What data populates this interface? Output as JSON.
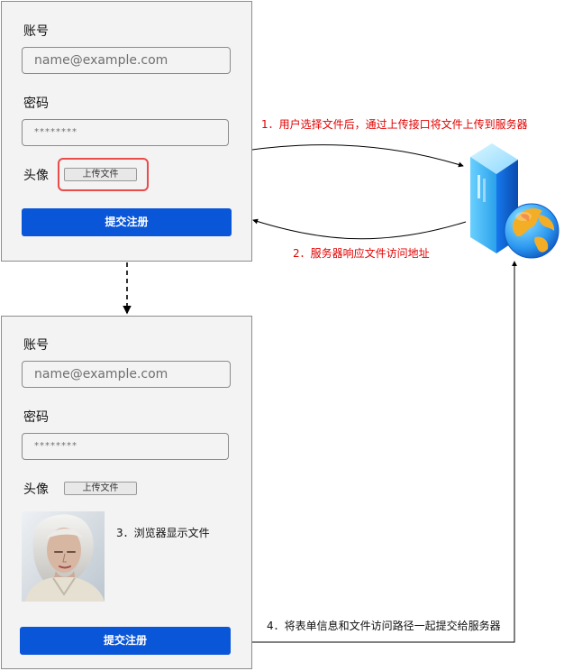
{
  "form_before": {
    "account_label": "账号",
    "account_placeholder": "name@example.com",
    "password_label": "密码",
    "password_value": "********",
    "avatar_label": "头像",
    "upload_label": "上传文件",
    "submit_label": "提交注册"
  },
  "form_after": {
    "account_label": "账号",
    "account_placeholder": "name@example.com",
    "password_label": "密码",
    "password_value": "********",
    "avatar_label": "头像",
    "upload_label": "上传文件",
    "submit_label": "提交注册"
  },
  "steps": {
    "step1": "1．用户选择文件后，通过上传接口将文件上传到服务器",
    "step2": "2．服务器响应文件访问地址",
    "step3": "3．浏览器显示文件",
    "step4": "4．将表单信息和文件访问路径一起提交给服务器"
  },
  "colors": {
    "primary": "#0a56d8",
    "highlight": "#ea4b4b",
    "annotation_red": "#e20000",
    "panel_bg": "#f3f3f3"
  },
  "icons": {
    "server": "server-globe-icon",
    "avatar": "portrait-image"
  }
}
